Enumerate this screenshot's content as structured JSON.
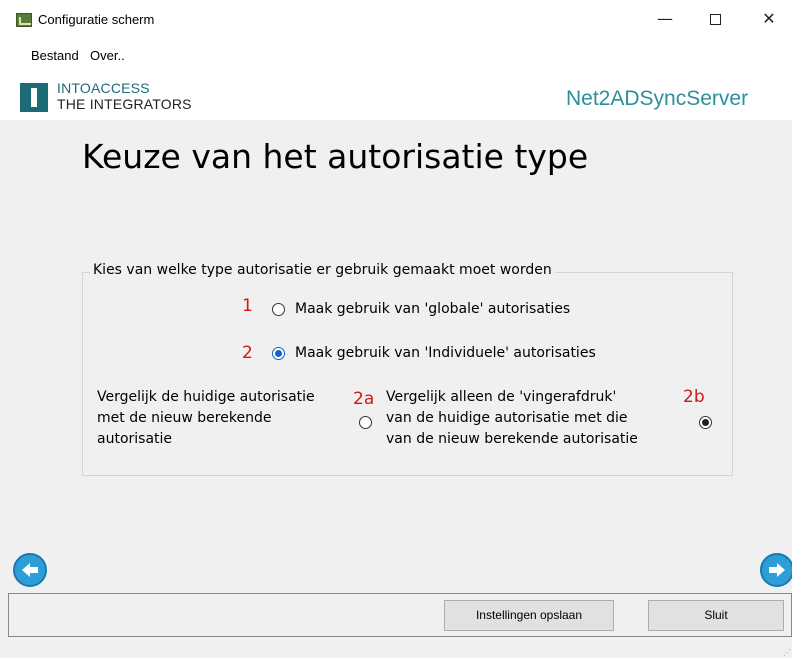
{
  "window": {
    "title": "Configuratie scherm",
    "minimize": "—",
    "close": "✕"
  },
  "menu": {
    "file": "Bestand",
    "about": "Over.."
  },
  "logo": {
    "line1": "INTOACCESS",
    "line2": "THE INTEGRATORS"
  },
  "product_name": "Net2ADSyncServer",
  "heading": "Keuze van het autorisatie type",
  "group": {
    "legend": "Kies van welke type autorisatie er gebruik gemaakt moet worden",
    "option1": {
      "number": "1",
      "label": "Maak gebruik van 'globale' autorisaties",
      "checked": false
    },
    "option2": {
      "number": "2",
      "label": "Maak gebruik van 'Individuele' autorisaties",
      "checked": true
    },
    "option2a": {
      "number": "2a",
      "line1": "Vergelijk de huidige autorisatie",
      "line2": "met de nieuw berekende",
      "line3": "autorisatie",
      "checked": false
    },
    "option2b": {
      "number": "2b",
      "line1": "Vergelijk alleen de 'vingerafdruk'",
      "line2": "van de huidige autorisatie met die",
      "line3": "van de nieuw berekende autorisatie",
      "checked": true
    }
  },
  "buttons": {
    "save": "Instellingen opslaan",
    "close": "Sluit"
  },
  "colors": {
    "accent": "#1e6b78",
    "product": "#2d8f9b",
    "number_red": "#d01818",
    "radio_blue": "#0a64c8",
    "arrow_blue": "#2e9fd6"
  },
  "icons": {
    "app": "app-icon",
    "back": "arrow-left-icon",
    "forward": "arrow-right-icon"
  }
}
